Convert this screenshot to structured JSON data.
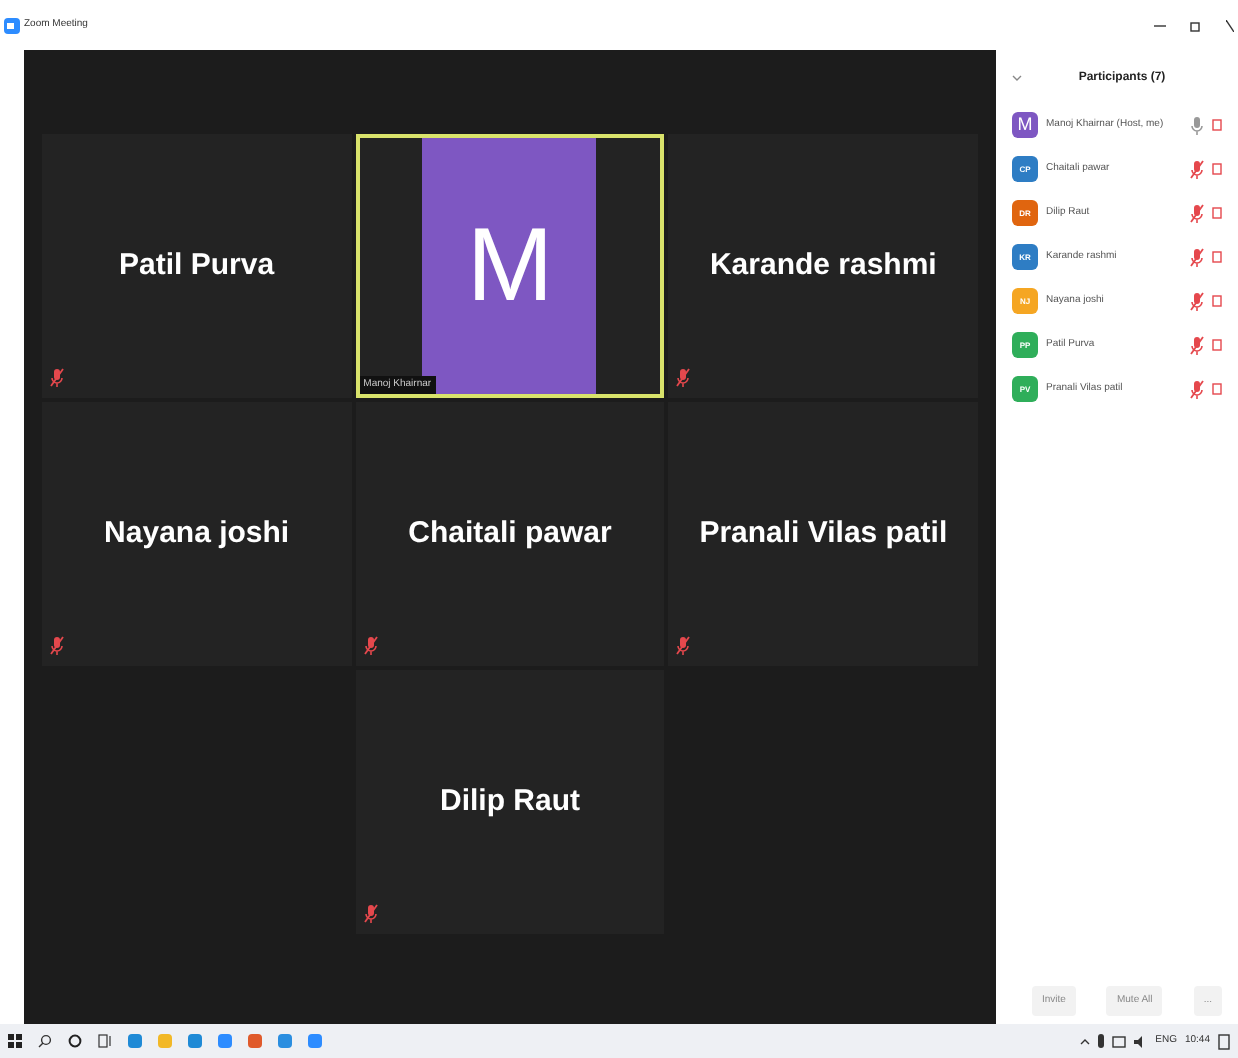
{
  "window": {
    "title": "Zoom Meeting"
  },
  "tiles": [
    {
      "kind": "name",
      "name": "Patil Purva",
      "muted": true,
      "speaking": false
    },
    {
      "kind": "avatar",
      "initial": "M",
      "name": "Manoj Khairnar",
      "muted": false,
      "speaking": true
    },
    {
      "kind": "name",
      "name": "Karande rashmi",
      "muted": true,
      "speaking": false
    },
    {
      "kind": "name",
      "name": "Nayana joshi",
      "muted": true,
      "speaking": false
    },
    {
      "kind": "name",
      "name": "Chaitali pawar",
      "muted": true,
      "speaking": false
    },
    {
      "kind": "name",
      "name": "Pranali Vilas patil",
      "muted": true,
      "speaking": false
    },
    {
      "kind": "name",
      "name": "Dilip Raut",
      "muted": true,
      "speaking": false
    }
  ],
  "participants": {
    "title": "Participants (7)",
    "items": [
      {
        "initials": "M",
        "name": "Manoj Khairnar (Host, me)",
        "color": "#7e57c2",
        "muted": false
      },
      {
        "initials": "CP",
        "name": "Chaitali pawar",
        "color": "#2e7dc4",
        "muted": true
      },
      {
        "initials": "DR",
        "name": "Dilip Raut",
        "color": "#e0650f",
        "muted": true
      },
      {
        "initials": "KR",
        "name": "Karande rashmi",
        "color": "#2e7dc4",
        "muted": true
      },
      {
        "initials": "NJ",
        "name": "Nayana joshi",
        "color": "#f5a623",
        "muted": true
      },
      {
        "initials": "PP",
        "name": "Patil Purva",
        "color": "#2fae5a",
        "muted": true
      },
      {
        "initials": "PV",
        "name": "Pranali Vilas patil",
        "color": "#2fae5a",
        "muted": true
      }
    ],
    "buttons": [
      "Invite",
      "Mute All",
      "..."
    ]
  },
  "tray": {
    "language": "ENG",
    "time": "10:44"
  }
}
